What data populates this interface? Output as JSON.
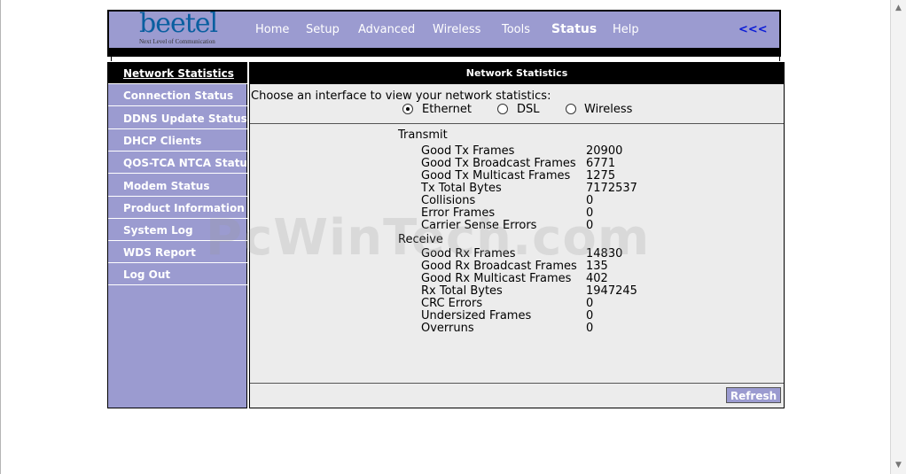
{
  "logo": {
    "word": "beetel",
    "tagline": "Next Level of Communication"
  },
  "nav": {
    "items": [
      "Home",
      "Setup",
      "Advanced",
      "Wireless",
      "Tools",
      "Status",
      "Help"
    ],
    "active": "Status",
    "back": "<<<"
  },
  "sidebar": {
    "items": [
      "Network Statistics",
      "Connection Status",
      "DDNS Update Status",
      "DHCP Clients",
      "QOS-TCA NTCA Status",
      "Modem Status",
      "Product Information",
      "System Log",
      "WDS Report",
      "Log Out"
    ]
  },
  "main": {
    "title": "Network Statistics",
    "prompt": "Choose an interface to view your network statistics:",
    "interfaces": [
      "Ethernet",
      "DSL",
      "Wireless"
    ],
    "selected_interface": "Ethernet",
    "transmit": {
      "heading": "Transmit",
      "rows": [
        {
          "label": "Good Tx Frames",
          "value": "20900"
        },
        {
          "label": "Good Tx Broadcast Frames",
          "value": "6771"
        },
        {
          "label": "Good Tx Multicast Frames",
          "value": "1275"
        },
        {
          "label": "Tx Total Bytes",
          "value": "7172537"
        },
        {
          "label": "Collisions",
          "value": "0"
        },
        {
          "label": "Error Frames",
          "value": "0"
        },
        {
          "label": "Carrier Sense Errors",
          "value": "0"
        }
      ]
    },
    "receive": {
      "heading": "Receive",
      "rows": [
        {
          "label": "Good Rx Frames",
          "value": "14830"
        },
        {
          "label": "Good Rx Broadcast Frames",
          "value": "135"
        },
        {
          "label": "Good Rx Multicast Frames",
          "value": "402"
        },
        {
          "label": "Rx Total Bytes",
          "value": "1947245"
        },
        {
          "label": "CRC Errors",
          "value": "0"
        },
        {
          "label": "Undersized Frames",
          "value": "0"
        },
        {
          "label": "Overruns",
          "value": "0"
        }
      ]
    },
    "refresh_label": "Refresh"
  },
  "watermark": "PcWinTech.com",
  "colors": {
    "accent": "#9b9bd0",
    "bar": "#000000",
    "panel": "#ececec",
    "link": "#0a1bd6"
  }
}
